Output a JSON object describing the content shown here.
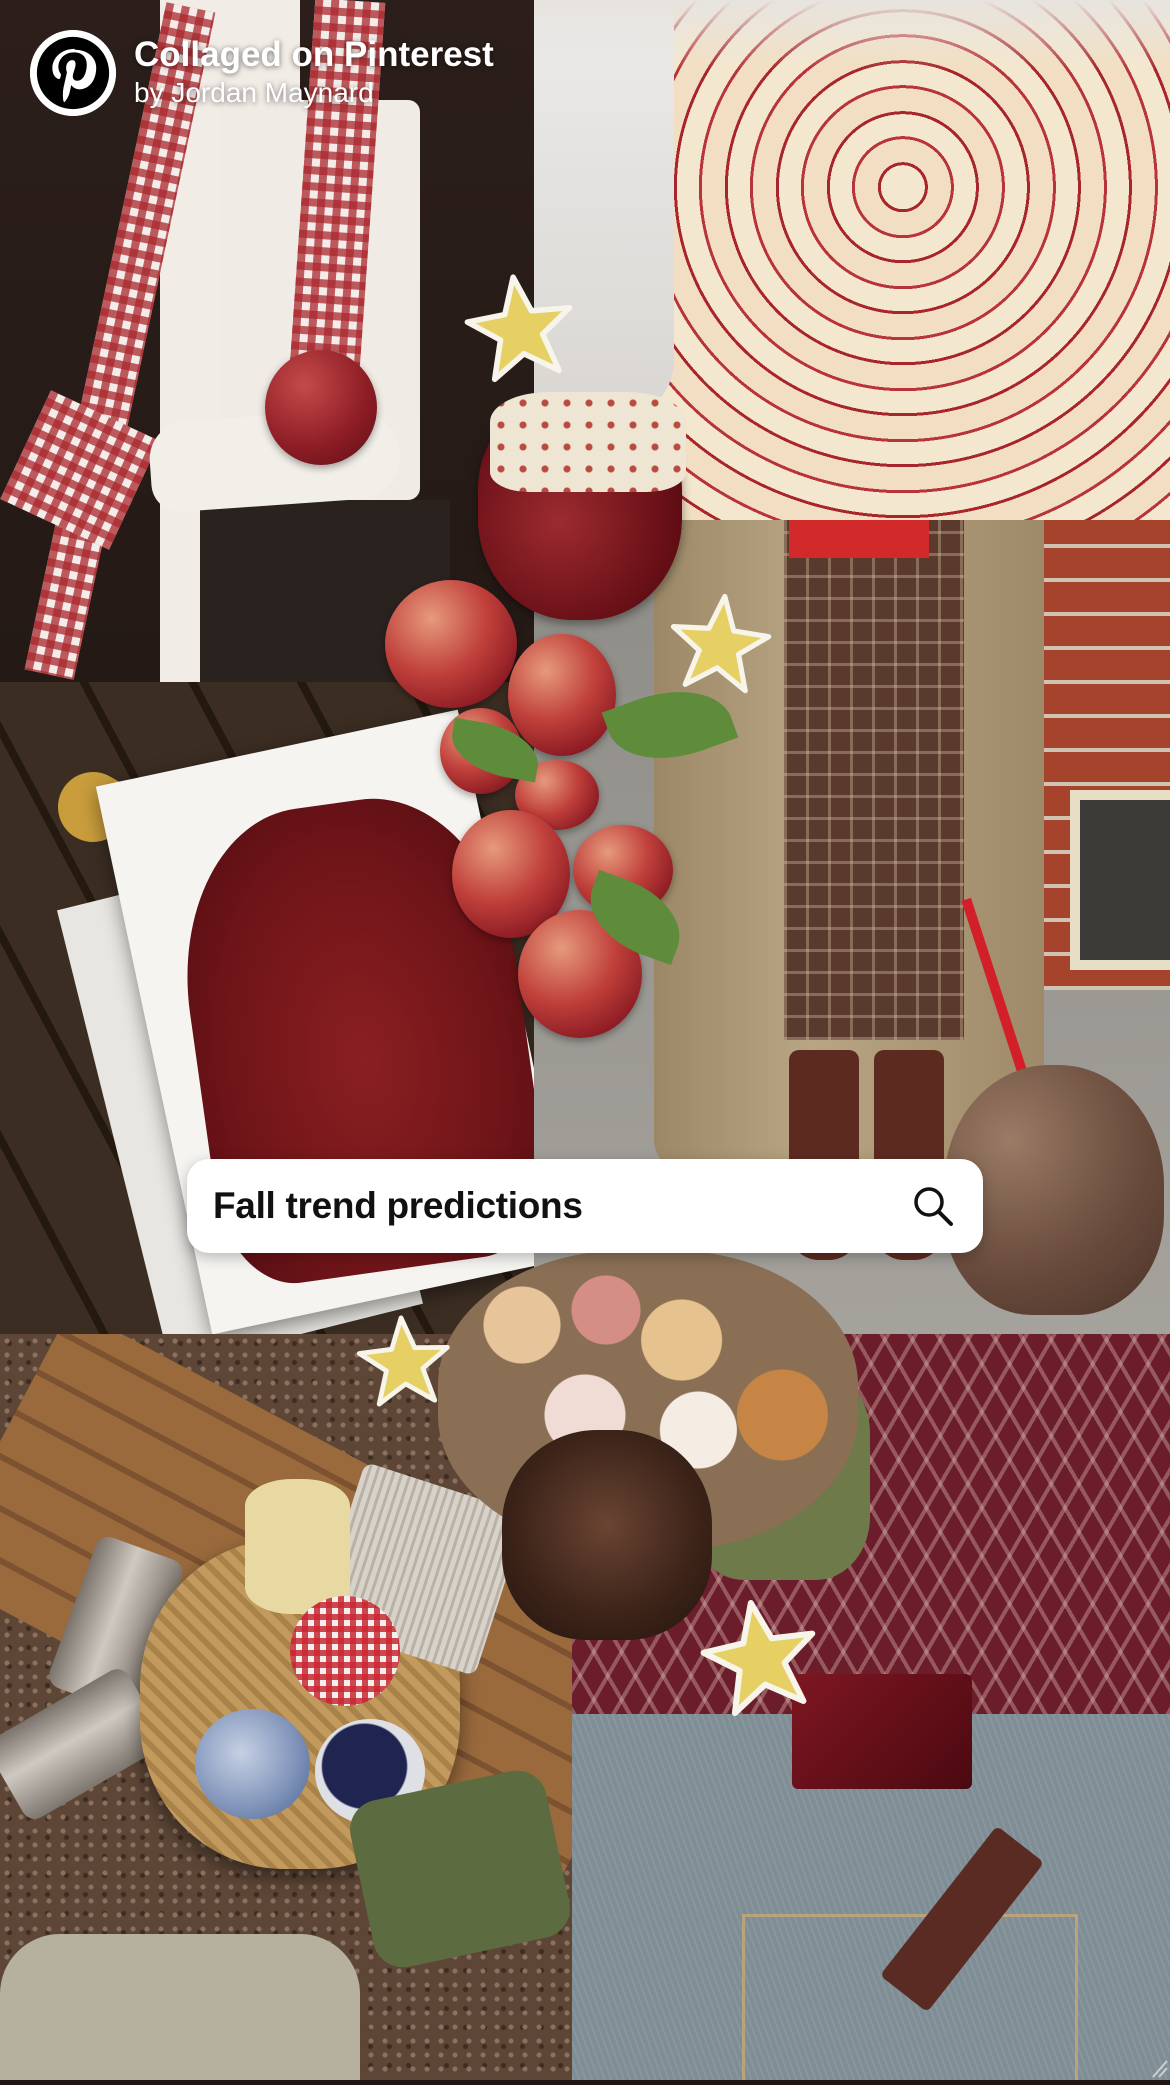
{
  "header": {
    "logo_icon": "pinterest-logo-icon",
    "title": "Collaged on Pinterest",
    "subtitle": "by Jordan Maynard"
  },
  "search": {
    "text": "Fall trend predictions",
    "icon": "search-icon"
  },
  "collage": {
    "tiles": [
      "dark suit with red gingham scarf holding an apple",
      "sliced apple tart",
      "red leather gloves on a magazine on a bench",
      "plaid skirt and trench coat with dachshund",
      "picnic basket with mugs on a bench",
      "burgundy knit sweater and jeans"
    ],
    "stickers": [
      "star",
      "star",
      "star",
      "star",
      "star"
    ]
  },
  "colors": {
    "search_bg": "#ffffff",
    "search_text": "#111111",
    "header_text": "#ffffff",
    "star_fill": "#e6cf63",
    "pin_red": "#000000"
  }
}
